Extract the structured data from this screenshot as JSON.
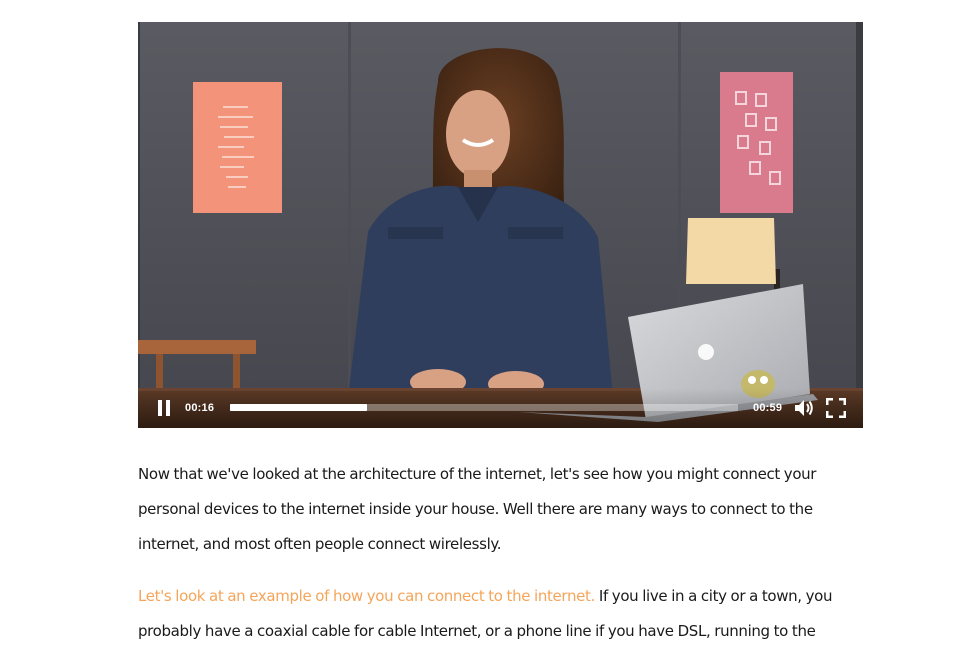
{
  "video": {
    "current_time": "00:16",
    "total_time": "00:59",
    "progress_fraction": 0.27,
    "buffered_fraction": 0.27,
    "controls": {
      "play_pause_icon": "pause-icon",
      "volume_icon": "volume-icon",
      "fullscreen_icon": "fullscreen-icon"
    }
  },
  "article": {
    "paragraph1": {
      "lines": [
        "Now that we've looked at the architecture of the internet, let's see how you might connect your",
        "personal devices to the internet inside your house. Well there are many ways to connect to the",
        "internet, and most often people connect wirelessly."
      ]
    },
    "paragraph2": {
      "highlight": "Let's look at an example of how you can connect to the internet.",
      "line1_rest": " If you live in a city or a town, you",
      "line2": "probably have a coaxial cable for cable Internet, or a phone line if you have DSL, running to the"
    }
  },
  "colors": {
    "highlight": "#f5a55a",
    "text": "#1a1a1a"
  }
}
